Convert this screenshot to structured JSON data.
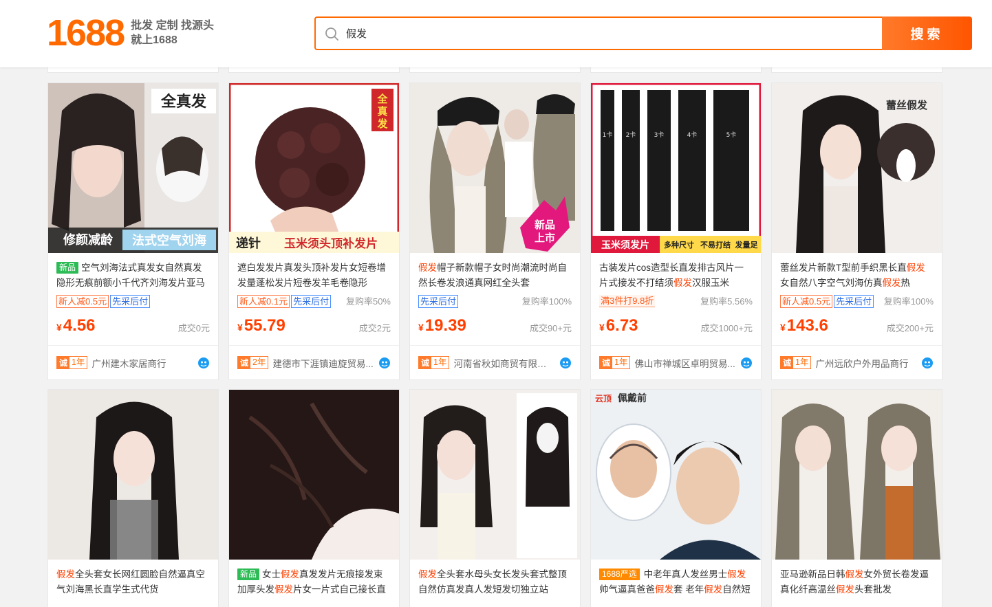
{
  "header": {
    "logo_text": "1688",
    "slogan_line1": "批发 定制 找源头",
    "slogan_line2": "就上1688",
    "search_value": "假发",
    "search_button": "搜索"
  },
  "products": [
    {
      "tag": "新品",
      "title_parts": [
        {
          "t": "空气刘海法式真发女自然真发隐形无痕前额小千代齐刘海发片亚马",
          "hl": false
        }
      ],
      "promos": [
        {
          "text": "新人减0.5元",
          "style": "orange"
        },
        {
          "text": "先采后付",
          "style": "blue"
        }
      ],
      "repurchase": "",
      "price": "4.56",
      "sales": "成交0元",
      "years": "1年",
      "shop": "广州建木家居商行",
      "img_text": [
        "全真发",
        "修颜减龄",
        "法式空气刘海"
      ]
    },
    {
      "tag": "",
      "title_parts": [
        {
          "t": "遮白发发片真发头顶补发片女短卷增发量蓬松发片短卷发羊毛卷隐形",
          "hl": false
        }
      ],
      "promos": [
        {
          "text": "新人减0.1元",
          "style": "orange"
        },
        {
          "text": "先采后付",
          "style": "blue"
        }
      ],
      "repurchase": "复购率50%",
      "price": "55.79",
      "sales": "成交2元",
      "years": "2年",
      "shop": "建德市下涯镇迪旋贸易...",
      "img_text": [
        "全真发",
        "递针",
        "玉米须头顶补发片"
      ]
    },
    {
      "tag": "",
      "title_parts": [
        {
          "t": "假发",
          "hl": true
        },
        {
          "t": "帽子新款帽子女时尚潮流时尚自然长卷发浪通真网红全头套",
          "hl": false
        }
      ],
      "promos": [
        {
          "text": "先采后付",
          "style": "blue"
        }
      ],
      "repurchase": "复购率100%",
      "price": "19.39",
      "sales": "成交90+元",
      "years": "1年",
      "shop": "河南省秋如商贸有限公司",
      "img_text": [
        "新品",
        "上市"
      ]
    },
    {
      "tag": "",
      "title_parts": [
        {
          "t": "古装发片cos造型长直发排古风片一片式接发不打结须",
          "hl": false
        },
        {
          "t": "假发",
          "hl": true
        },
        {
          "t": "汉服玉米",
          "hl": false
        }
      ],
      "promos": [
        {
          "text": "满3件打9.8折",
          "style": "full"
        }
      ],
      "repurchase": "复购率5.56%",
      "price": "6.73",
      "sales": "成交1000+元",
      "years": "1年",
      "shop": "佛山市禅城区卓明贸易...",
      "img_text": [
        "玉米须发片",
        "多种尺寸",
        "不易打结",
        "发量足",
        "1卡",
        "2卡",
        "3卡",
        "4卡",
        "5卡"
      ]
    },
    {
      "tag": "",
      "title_parts": [
        {
          "t": "蕾丝发片新款T型前手织黑长直",
          "hl": false
        },
        {
          "t": "假发",
          "hl": true
        },
        {
          "t": "女自然八字空气刘海仿真",
          "hl": false
        },
        {
          "t": "假发",
          "hl": true
        },
        {
          "t": "热",
          "hl": false
        }
      ],
      "promos": [
        {
          "text": "新人减0.5元",
          "style": "orange"
        },
        {
          "text": "先采后付",
          "style": "blue"
        }
      ],
      "repurchase": "复购率100%",
      "price": "143.6",
      "sales": "成交200+元",
      "years": "1年",
      "shop": "广州远欣户外用品商行",
      "img_text": [
        "蕾丝假发"
      ]
    },
    {
      "tag": "",
      "title_parts": [
        {
          "t": "假发",
          "hl": true
        },
        {
          "t": "全头套女长网红圆脸自然逼真空气刘海黑长直学生式代货",
          "hl": false
        }
      ]
    },
    {
      "tag": "新品",
      "title_parts": [
        {
          "t": "女士",
          "hl": false
        },
        {
          "t": "假发",
          "hl": true
        },
        {
          "t": "真发发片无痕接发束加厚头发",
          "hl": false
        },
        {
          "t": "假发",
          "hl": true
        },
        {
          "t": "片女一片式自己接长直",
          "hl": false
        }
      ]
    },
    {
      "tag": "",
      "title_parts": [
        {
          "t": "假发",
          "hl": true
        },
        {
          "t": "全头套水母头女长发头套式整顶自然仿真发真人发短发切独立站",
          "hl": false
        }
      ]
    },
    {
      "tag": "1688严选",
      "title_parts": [
        {
          "t": "中老年真人发丝男士",
          "hl": false
        },
        {
          "t": "假发",
          "hl": true
        },
        {
          "t": "帅气逼真爸爸",
          "hl": false
        },
        {
          "t": "假发",
          "hl": true
        },
        {
          "t": "套 老年",
          "hl": false
        },
        {
          "t": "假发",
          "hl": true
        },
        {
          "t": "自然短",
          "hl": false
        }
      ],
      "img_text": [
        "云顶",
        "佩戴前"
      ]
    },
    {
      "tag": "",
      "title_parts": [
        {
          "t": "亚马逊新品日韩",
          "hl": false
        },
        {
          "t": "假发",
          "hl": true
        },
        {
          "t": "女外贸长卷发逼真化纤高温丝",
          "hl": false
        },
        {
          "t": "假发",
          "hl": true
        },
        {
          "t": "头套批发",
          "hl": false
        }
      ]
    }
  ],
  "colors": {
    "accent": "#ff6a00",
    "price": "#ff4000",
    "new_tag": "#2dbb55",
    "blue_tag": "#2f6fe0"
  }
}
